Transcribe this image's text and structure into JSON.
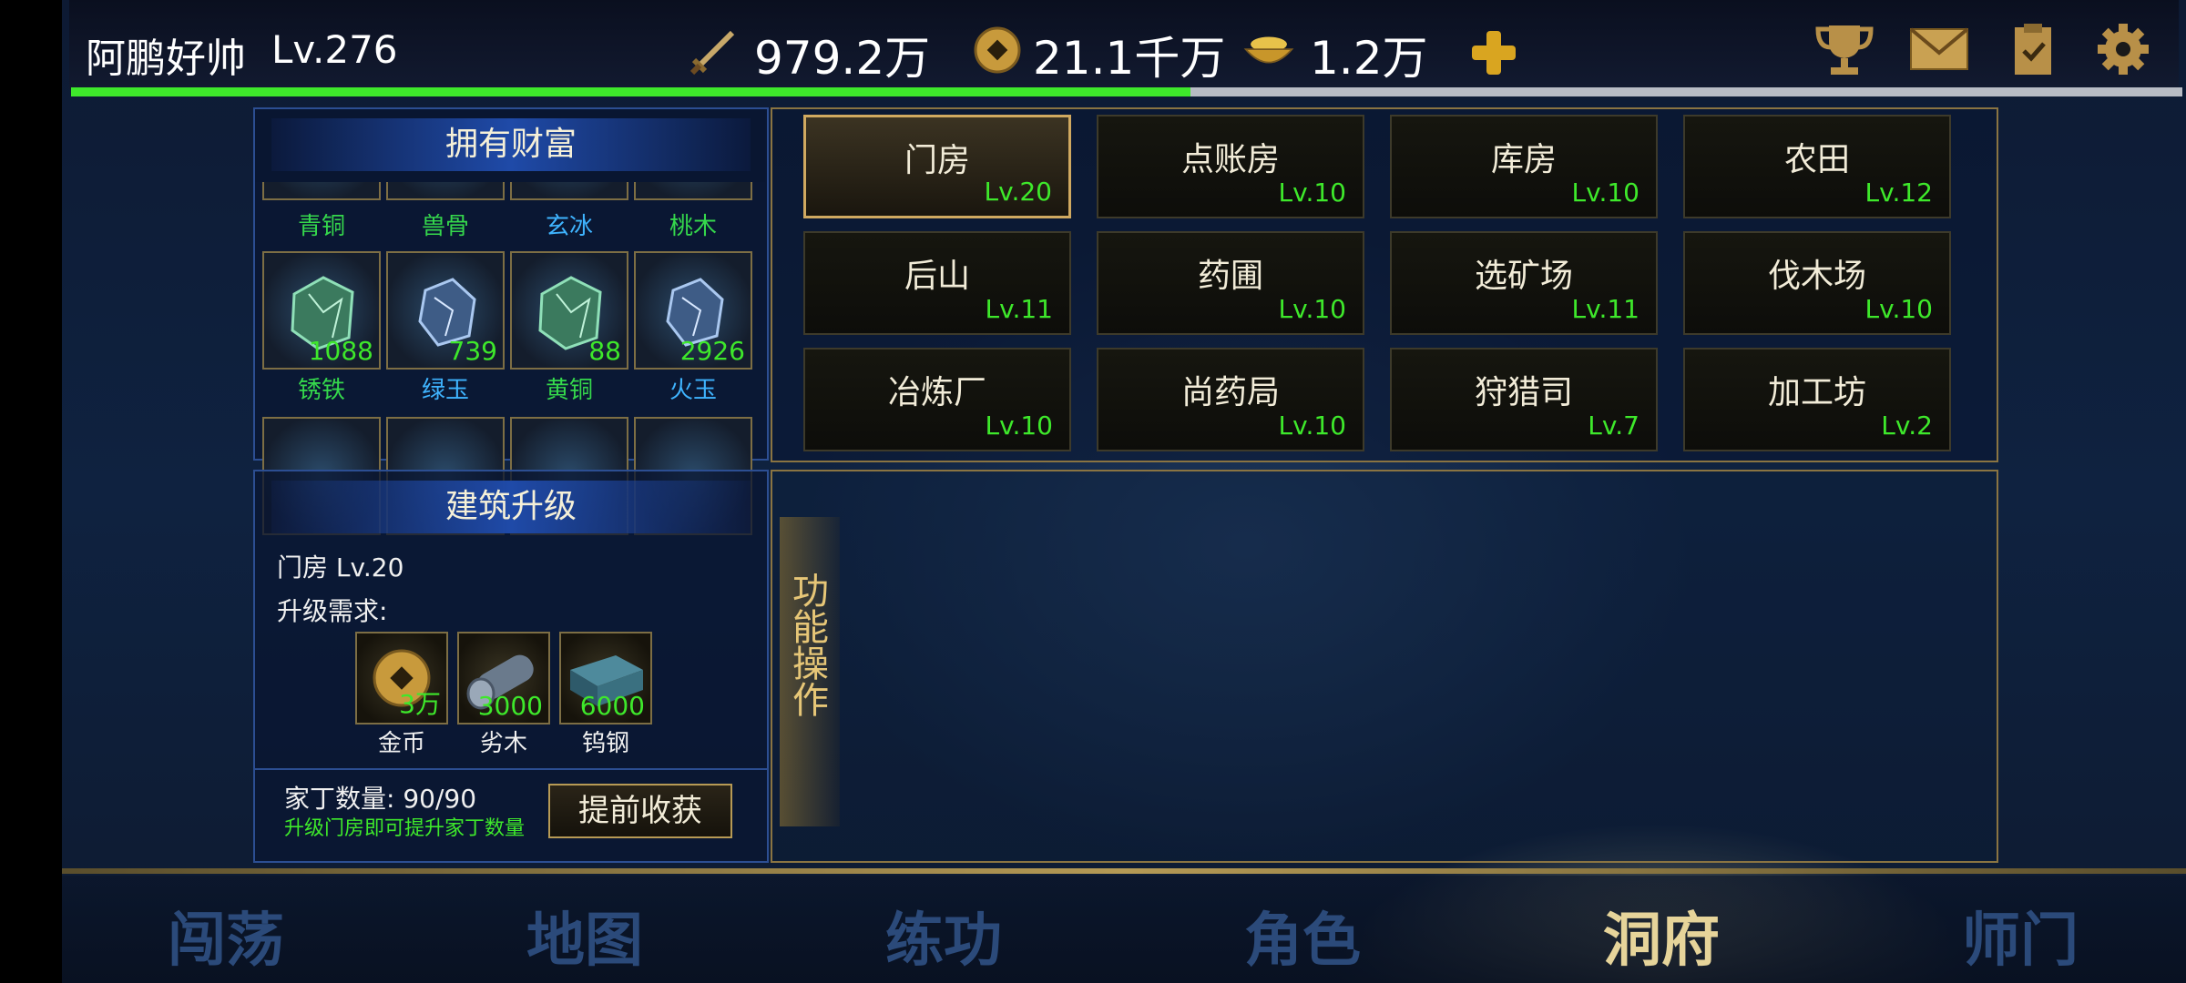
{
  "player": {
    "name": "阿鹏好帅",
    "level": "Lv.276",
    "exp_fraction": 0.53
  },
  "resources": {
    "power": "979.2万",
    "coins": "21.1千万",
    "ingots": "1.2万"
  },
  "icons": {
    "power": "sword-icon",
    "coins": "coin-icon",
    "ingots": "ingot-bowl-icon",
    "add": "plus-icon",
    "ranking": "trophy-icon",
    "mail": "mail-icon",
    "tasks": "clipboard-icon",
    "settings": "gear-icon"
  },
  "colors": {
    "exp_bar": "#3ee82b",
    "level_text": "#3ee82b",
    "accent_gold": "#d0a960",
    "panel_blue": "#2c4e92"
  },
  "wealth": {
    "title": "拥有财富",
    "top_labels": [
      {
        "name": "青铜",
        "color": "green"
      },
      {
        "name": "兽骨",
        "color": "green"
      },
      {
        "name": "玄冰",
        "color": "blue"
      },
      {
        "name": "桃木",
        "color": "green"
      }
    ],
    "items": [
      {
        "name": "锈铁",
        "qty": "1088",
        "color": "green",
        "kind": "green"
      },
      {
        "name": "绿玉",
        "qty": "739",
        "color": "blue",
        "kind": "blue"
      },
      {
        "name": "黄铜",
        "qty": "88",
        "color": "green",
        "kind": "green"
      },
      {
        "name": "火玉",
        "qty": "2926",
        "color": "blue",
        "kind": "blue"
      }
    ]
  },
  "buildings": [
    {
      "name": "门房",
      "level": "Lv.20"
    },
    {
      "name": "点账房",
      "level": "Lv.10"
    },
    {
      "name": "库房",
      "level": "Lv.10"
    },
    {
      "name": "农田",
      "level": "Lv.12"
    },
    {
      "name": "后山",
      "level": "Lv.11"
    },
    {
      "name": "药圃",
      "level": "Lv.10"
    },
    {
      "name": "选矿场",
      "level": "Lv.11"
    },
    {
      "name": "伐木场",
      "level": "Lv.10"
    },
    {
      "name": "冶炼厂",
      "level": "Lv.10"
    },
    {
      "name": "尚药局",
      "level": "Lv.10"
    },
    {
      "name": "狩猎司",
      "level": "Lv.7"
    },
    {
      "name": "加工坊",
      "level": "Lv.2"
    }
  ],
  "upgrade": {
    "title": "建筑升级",
    "building": "门房 Lv.20",
    "req_label": "升级需求:",
    "requirements": [
      {
        "name": "金币",
        "qty": "3万",
        "icon": "coin-icon"
      },
      {
        "name": "劣木",
        "qty": "3000",
        "icon": "log-icon"
      },
      {
        "name": "钨钢",
        "qty": "6000",
        "icon": "steel-ore-icon"
      }
    ],
    "servants": "家丁数量: 90/90",
    "hint": "升级门房即可提升家丁数量",
    "early_button": "提前收获"
  },
  "function_panel": {
    "tab_label": "功能操作"
  },
  "nav": [
    "闯荡",
    "地图",
    "练功",
    "角色",
    "洞府",
    "师门"
  ],
  "nav_active": "洞府"
}
